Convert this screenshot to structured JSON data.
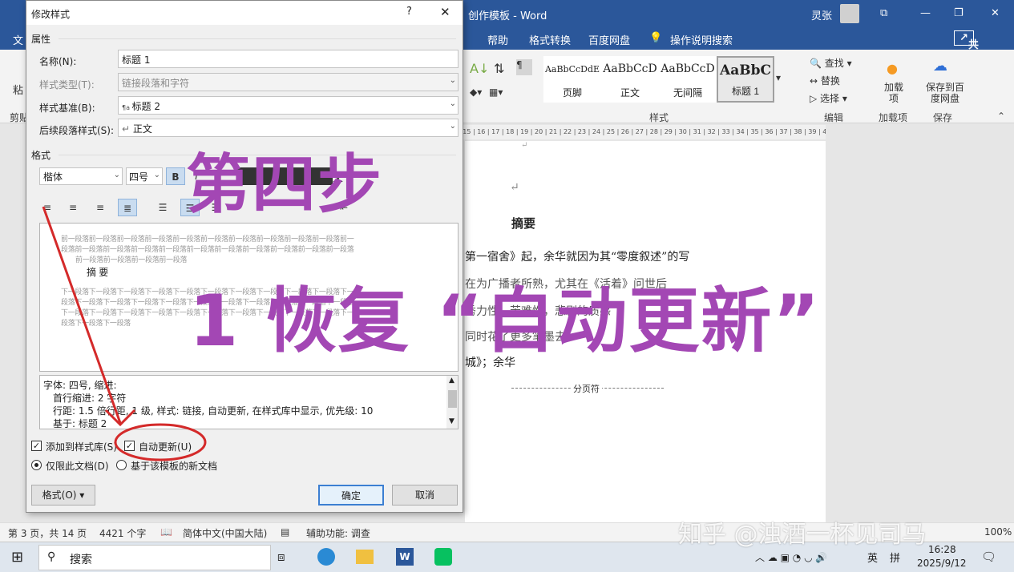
{
  "word": {
    "title": "创作模板 - Word",
    "user": "灵张",
    "tabs": [
      "文",
      "帮助",
      "格式转换",
      "百度网盘",
      "操作说明搜索"
    ],
    "share": "共享",
    "ribbon": {
      "left_partial_1": "粘",
      "left_partial_2": "剪贴",
      "styles": [
        {
          "preview": "AaBbCcDdE",
          "label": "页脚"
        },
        {
          "preview": "AaBbCcD",
          "label": "正文"
        },
        {
          "preview": "AaBbCcD",
          "label": "无间隔"
        },
        {
          "preview": "AaBbC",
          "label": "标题 1"
        }
      ],
      "find": "查找",
      "replace": "替换",
      "select": "选择",
      "addin": "加载项",
      "save_to_baidu": "保存到百度网盘",
      "group_styles": "样式",
      "group_edit": "编辑",
      "group_addin": "加载项",
      "group_save": "保存"
    },
    "ruler_text": "| 15 | 16 | 17 | 18 | 19 | 20 | 21 | 22 | 23 | 24 | 25 | 26 | 27 | 28 | 29 | 30 | 31 | 32 | 33 | 34 | 35 | 36 | 37 | 38 | 39 | 40 | 41 | 42",
    "document": {
      "heading": "摘要",
      "line1": "第一宿舍》起，余华就因为其“零度叙述”的写",
      "line2": "在为广播者所熟，尤其在《活着》问世后",
      "line3": "秀力性，苦难性，悲剧的质感",
      "line4": "同时花了更多笔墨去",
      "line5": "城》；余华",
      "page_break": "分页符"
    },
    "status": {
      "page": "第 3 页，共 14 页",
      "words": "4421 个字",
      "lang": "简体中文(中国大陆)",
      "access": "辅助功能: 调查",
      "zoom": "100%"
    }
  },
  "dialog": {
    "title": "修改样式",
    "help": "?",
    "close": "✕",
    "section_props": "属性",
    "name_label": "名称(N):",
    "name_value": "标题 1",
    "type_label": "样式类型(T):",
    "type_value": "链接段落和字符",
    "base_label": "样式基准(B):",
    "base_value": "标题 2",
    "next_label": "后续段落样式(S):",
    "next_value": "正文",
    "section_format": "格式",
    "font": "楷体",
    "size": "四号",
    "bold": "B",
    "lang_partial": "文",
    "preview": {
      "prev_1": "前一段落前一段落前一段落前一段落前一段落前一段落前一段落前一段落前一段落前一段落前一",
      "prev_2": "段落前一段落前一段落前一段落前一段落前一段落前一段落前一段落前一段落前一段落前一段落",
      "prev_3": "前一段落前一段落前一段落前一段落",
      "heading": "摘 要",
      "next_1": "下一段落下一段落下一段落下一段落下一段落下一段落下一段落下一段落下一段落下一段落下一",
      "next_2": "段落下一段落下一段落下一段落下一段落下一段落下一段落下一段落下一段落下一段落下一段落",
      "next_3": "下一段落下一段落下一段落下一段落下一段落下一段落下一段落下一段落下一段落下一段落下一",
      "next_4": "段落下一段落下一段落"
    },
    "desc": {
      "line1": "字体: 四号, 缩进:",
      "line2": "首行缩进:  2 字符",
      "line3": "行距: 1.5 倍行距, 1 级, 样式: 链接, 自动更新, 在样式库中显示, 优先级: 10",
      "line4": "基于: 标题 2"
    },
    "add_to_gallery": "添加到样式库(S)",
    "auto_update": "自动更新(U)",
    "only_this_doc": "仅限此文档(D)",
    "new_docs": "基于该模板的新文档",
    "format_btn": "格式(O) ▾",
    "ok": "确定",
    "cancel": "取消"
  },
  "overlay": {
    "step": "第四步",
    "instruction": "1 恢复 “自动更新”"
  },
  "watermark": "知乎 @浊酒一杯见司马",
  "taskbar": {
    "search": "搜索",
    "ime": "英",
    "time": "16:28",
    "date": "2025/9/12"
  }
}
